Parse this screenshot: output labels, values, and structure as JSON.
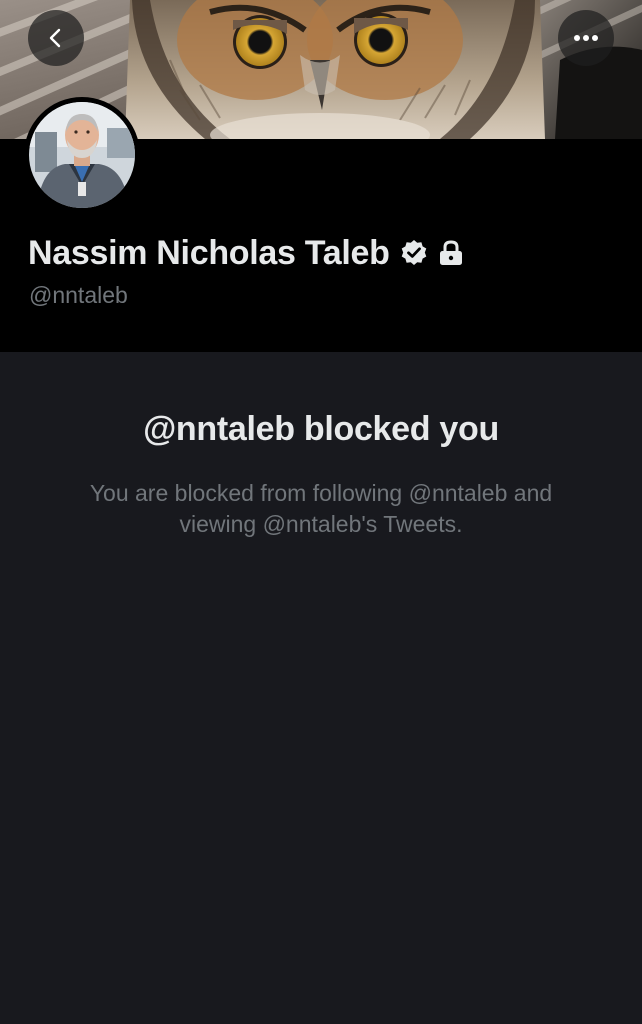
{
  "icons": {
    "back": "chevron-left-icon",
    "more": "more-horizontal-icon",
    "verified": "verified-badge-icon",
    "protected": "lock-icon"
  },
  "profile": {
    "display_name": "Nassim Nicholas Taleb",
    "handle": "@nntaleb"
  },
  "blocked": {
    "title": "@nntaleb blocked you",
    "message": "You are blocked from following @nntaleb and viewing @nntaleb's Tweets."
  },
  "colors": {
    "page_background": "#18191e",
    "header_background": "#000000",
    "primary_text": "#e7e9ea",
    "secondary_text": "#71767b"
  }
}
